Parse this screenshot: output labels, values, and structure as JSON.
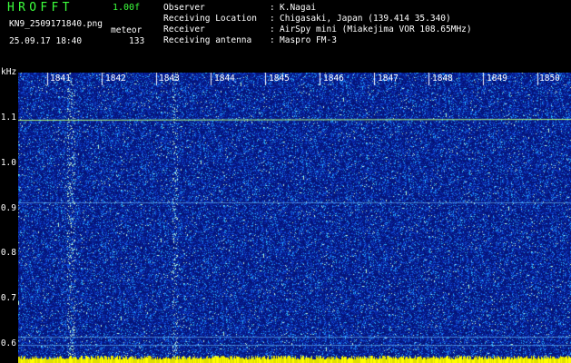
{
  "app": {
    "title": "HROFFT",
    "version": "1.00f"
  },
  "file": {
    "name": "KN9_2509171840.png",
    "meteor_label": "meteor",
    "datetime": "25.09.17 18:40",
    "count": "133"
  },
  "info": [
    {
      "label": "Observer",
      "value": "K.Nagai"
    },
    {
      "label": "Receiving Location",
      "value": "Chigasaki, Japan (139.414 35.340)"
    },
    {
      "label": "Receiver",
      "value": "AirSpy mini (Miakejima VOR 108.65MHz)"
    },
    {
      "label": "Receiving antenna",
      "value": "Maspro FM-3"
    }
  ],
  "axis": {
    "unit": "kHz",
    "y_ticks": [
      "1.1",
      "1.0",
      "0.9",
      "0.8",
      "0.7",
      "0.6"
    ],
    "x_ticks": [
      "1841",
      "1842",
      "1843",
      "1844",
      "1845",
      "1846",
      "1847",
      "1848",
      "1849",
      "1850"
    ]
  },
  "colors": {
    "title": "#3cff3c",
    "background": "#000000",
    "spectrum_base": "#0a1c8c",
    "line": "#b4ff78"
  }
}
